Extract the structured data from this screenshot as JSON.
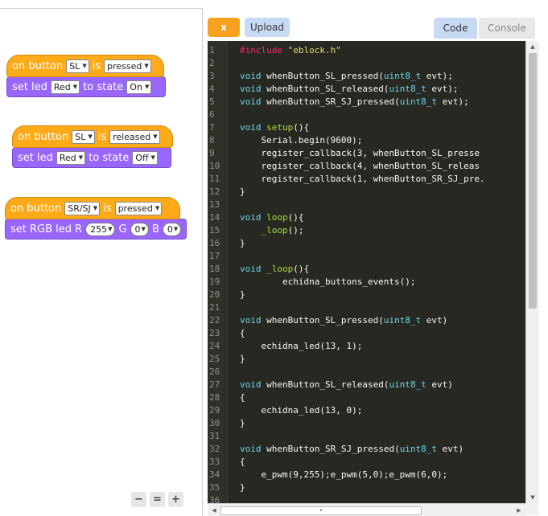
{
  "workspace": {
    "block1": {
      "hat_prefix": "on button",
      "button_value": "SL",
      "hat_is": "is",
      "state_value": "pressed",
      "cmd_prefix": "set led",
      "led_value": "Red",
      "cmd_to": "to state",
      "led_state": "On"
    },
    "block2": {
      "hat_prefix": "on button",
      "button_value": "SL",
      "hat_is": "is",
      "state_value": "released",
      "cmd_prefix": "set led",
      "led_value": "Red",
      "cmd_to": "to state",
      "led_state": "Off"
    },
    "block3": {
      "hat_prefix": "on button",
      "button_value": "SR/SJ",
      "hat_is": "is",
      "state_value": "pressed",
      "cmd_prefix": "set RGB led",
      "r_label": "R",
      "r_value": "255",
      "g_label": "G",
      "g_value": "0",
      "b_label": "B",
      "b_value": "0"
    },
    "zoom": {
      "out": "−",
      "reset": "=",
      "in": "+"
    }
  },
  "toolbar": {
    "x_label": "x",
    "upload_label": "Upload",
    "code_tab": "Code",
    "console_tab": "Console"
  },
  "editor": {
    "line_numbers": [
      "1",
      "2",
      "3",
      "4",
      "5",
      "6",
      "7",
      "8",
      "9",
      "10",
      "11",
      "12",
      "13",
      "14",
      "15",
      "16",
      "17",
      "18",
      "19",
      "20",
      "21",
      "22",
      "23",
      "24",
      "25",
      "26",
      "27",
      "28",
      "29",
      "30",
      "31",
      "32",
      "33",
      "34",
      "35",
      "36"
    ],
    "lines": [
      "#include \"eblock.h\"",
      "",
      "void whenButton_SL_pressed(uint8_t evt);",
      "void whenButton_SL_released(uint8_t evt);",
      "void whenButton_SR_SJ_pressed(uint8_t evt);",
      "",
      "void setup(){",
      "    Serial.begin(9600);",
      "    register_callback(3, whenButton_SL_presse",
      "    register_callback(4, whenButton_SL_releas",
      "    register_callback(1, whenButton_SR_SJ_pre.",
      "}",
      "",
      "void loop(){",
      "    _loop();",
      "}",
      "",
      "void _loop(){",
      "        echidna_buttons_events();",
      "}",
      "",
      "void whenButton_SL_pressed(uint8_t evt)",
      "{",
      "    echidna_led(13, 1);",
      "}",
      "",
      "void whenButton_SL_released(uint8_t evt)",
      "{",
      "    echidna_led(13, 0);",
      "}",
      "",
      "void whenButton_SR_SJ_pressed(uint8_t evt)",
      "{",
      "    e_pwm(9,255);e_pwm(5,0);e_pwm(6,0);",
      "}",
      ""
    ]
  },
  "colors": {
    "event_block": "#ffab19",
    "looks_block": "#9966ff",
    "editor_bg": "#272822",
    "keyword": "#66d9ef",
    "preprocessor": "#f92672",
    "string": "#e6db74"
  },
  "icons": {
    "zoom_out": "zoom-out-icon",
    "zoom_reset": "zoom-reset-icon",
    "zoom_in": "zoom-in-icon"
  }
}
